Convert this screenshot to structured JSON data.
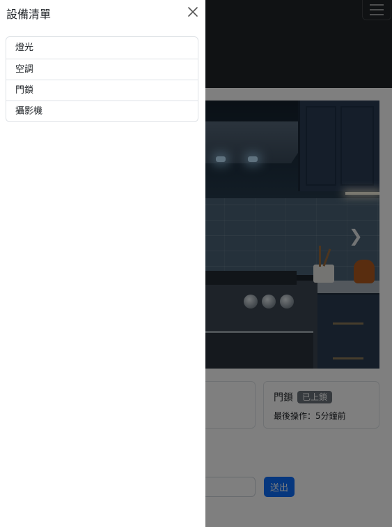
{
  "offcanvas": {
    "title": "設備清單",
    "items": [
      {
        "label": "燈光"
      },
      {
        "label": "空調"
      },
      {
        "label": "門鎖"
      },
      {
        "label": "攝影機"
      }
    ]
  },
  "hero": {
    "next_icon": "chevron-right-icon"
  },
  "cards": [
    {
      "title": "門鎖",
      "badge": "已上鎖",
      "subtitle": "最後操作：5分鐘前"
    }
  ],
  "command": {
    "input_value": "",
    "send_label": "送出"
  },
  "colors": {
    "navbar": "#212529",
    "primary": "#0d6efd",
    "badge": "#6c757d",
    "backdrop": "rgba(0,0,0,0.5)"
  }
}
